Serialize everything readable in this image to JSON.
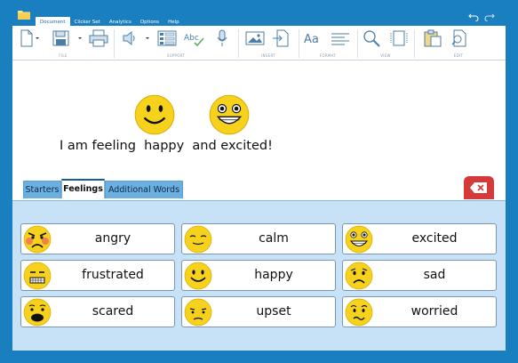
{
  "menu": [
    "Document",
    "Clicker Set",
    "Analytics",
    "Options",
    "Help"
  ],
  "active_menu": "Document",
  "ribbon": {
    "groups": [
      "FILE",
      "SUPPORT",
      "INSERT",
      "FORMAT",
      "VIEW",
      "EDIT"
    ],
    "format_text_icon": "Aa",
    "spell_icon_text": "Abc"
  },
  "sentence": "I am feeling  happy  and excited!",
  "tabs": [
    "Starters",
    "Feelings",
    "Additional Words"
  ],
  "active_tab": "Feelings",
  "cells": [
    {
      "label": "angry",
      "icon": "angry-face-icon"
    },
    {
      "label": "calm",
      "icon": "calm-face-icon"
    },
    {
      "label": "excited",
      "icon": "excited-face-icon"
    },
    {
      "label": "frustrated",
      "icon": "frustrated-face-icon"
    },
    {
      "label": "happy",
      "icon": "happy-face-icon"
    },
    {
      "label": "sad",
      "icon": "sad-face-icon"
    },
    {
      "label": "scared",
      "icon": "scared-face-icon"
    },
    {
      "label": "upset",
      "icon": "upset-face-icon"
    },
    {
      "label": "worried",
      "icon": "worried-face-icon"
    }
  ],
  "colors": {
    "frame": "#1a7fbf",
    "tab": "#6bb0e0",
    "grid": "#c7e1f6",
    "backspace": "#d43a3a",
    "face": "#f6d21c"
  }
}
